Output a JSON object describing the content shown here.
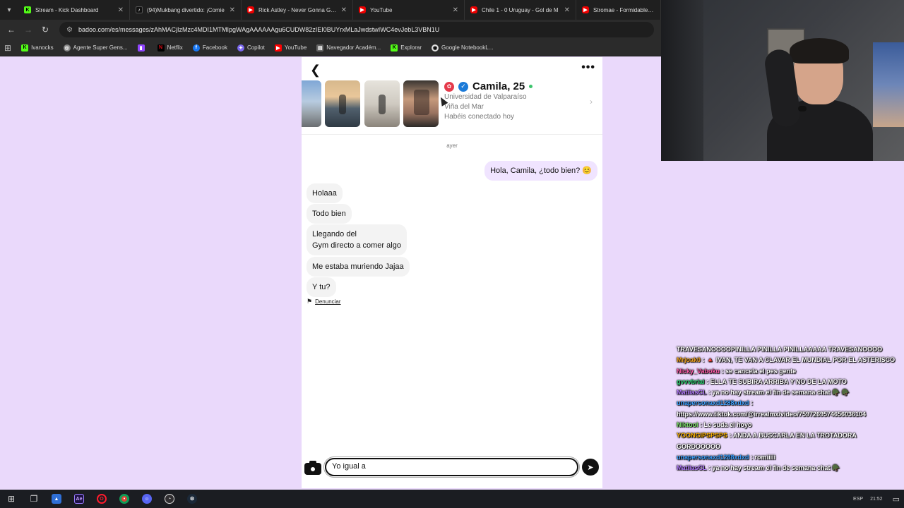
{
  "browser": {
    "tabs": [
      {
        "title": "Stream - Kick Dashboard",
        "icon": "kick-icon"
      },
      {
        "title": "(94)Mukbang divertido: ¡Comie",
        "icon": "tiktok-icon"
      },
      {
        "title": "Rick Astley - Never Gonna Give",
        "icon": "youtube-icon"
      },
      {
        "title": "YouTube",
        "icon": "youtube-icon"
      },
      {
        "title": "Chile 1 - 0 Uruguay - Gol de M",
        "icon": "youtube-icon"
      },
      {
        "title": "Stromae - Formidable (Lyric",
        "icon": "youtube-icon"
      }
    ],
    "url": "badoo.com/es/messages/zAhMACjIzMzc4MDI1MTMIpgWAgAAAAAAgu6CUDW82zIEI0BUYrxMLaJwdstwIWC4evJebL3VBN1U",
    "bookmarks": [
      {
        "label": "Ivanocks",
        "icon": "kick-icon",
        "color": "#53fc18"
      },
      {
        "label": "Agente Super Gens...",
        "icon": "agent-icon",
        "color": "#888888"
      },
      {
        "label": "",
        "icon": "twitch-icon",
        "color": "#9146ff"
      },
      {
        "label": "Netflix",
        "icon": "netflix-icon",
        "color": "#e50914"
      },
      {
        "label": "Facebook",
        "icon": "facebook-icon",
        "color": "#1877f2"
      },
      {
        "label": "Copilot",
        "icon": "copilot-icon",
        "color": "#7b68ee"
      },
      {
        "label": "YouTube",
        "icon": "youtube-icon",
        "color": "#ff0000"
      },
      {
        "label": "Navegador Académ...",
        "icon": "doc-icon",
        "color": "#888888"
      },
      {
        "label": "Explorar",
        "icon": "kick-icon",
        "color": "#53fc18"
      },
      {
        "label": "Google NotebookL...",
        "icon": "notebooklm-icon",
        "color": "#dddddd"
      }
    ]
  },
  "badoo": {
    "profile": {
      "name": "Camila, 25",
      "university": "Universidad de Valparaíso",
      "city": "Viña del Mar",
      "status": "Habéis conectado hoy"
    },
    "day_label": "ayer",
    "messages": [
      {
        "from": "me",
        "text": "Hola, Camila, ¿todo bien? 😊"
      },
      {
        "from": "them",
        "text": "Holaaa"
      },
      {
        "from": "them",
        "text": "Todo bien"
      },
      {
        "from": "them",
        "line1": "Llegando del",
        "line2": "Gym directo a comer algo"
      },
      {
        "from": "them",
        "text": "Me estaba muriendo Jajaa"
      },
      {
        "from": "them",
        "text": "Y tu?"
      }
    ],
    "report_label": "Denunciar",
    "composer_value": "Yo igual a"
  },
  "stream_chat": [
    {
      "user": "",
      "text": "TRAVESANOOOOPINILLA PINILLA PINILLAAAAA TRAVESANOOOO"
    },
    {
      "user": "Mrjoak0",
      "text": ": 🔺 IVAN, TE VAN A CLAVAR EL MUNDIAL POR EL ASTERISCO"
    },
    {
      "user": "Nicky_Vaboku",
      "text": ": se cancela el pes gente"
    },
    {
      "user": "gvvvbrial",
      "text": ": ELLA TE SUBIRA ARRIBA Y NO DE LA MOTO"
    },
    {
      "user": "MatiiasCL",
      "text": ": ya no hay stream el fin de semana chat 🪖 🪖"
    },
    {
      "user": "unapersonaxd1288xdxd",
      "text": ": https://www.tiktok.com/@irrealmx/video/7597269574656036104"
    },
    {
      "user": "Niktool",
      "text": ": Le suda el hoyo"
    },
    {
      "user": "YOONGIPSPSPS",
      "text": ": ANDA A BUSCARLA EN LA TROTADORA GORDOOOOO"
    },
    {
      "user": "unapersonaxd1288xdxd",
      "text": ": romiiiii"
    },
    {
      "user": "MatiiasCL",
      "text": ": ya no hay stream el fin de semana chat 🪖"
    }
  ],
  "taskbar": {
    "language": "ESP",
    "time": "21:52"
  }
}
